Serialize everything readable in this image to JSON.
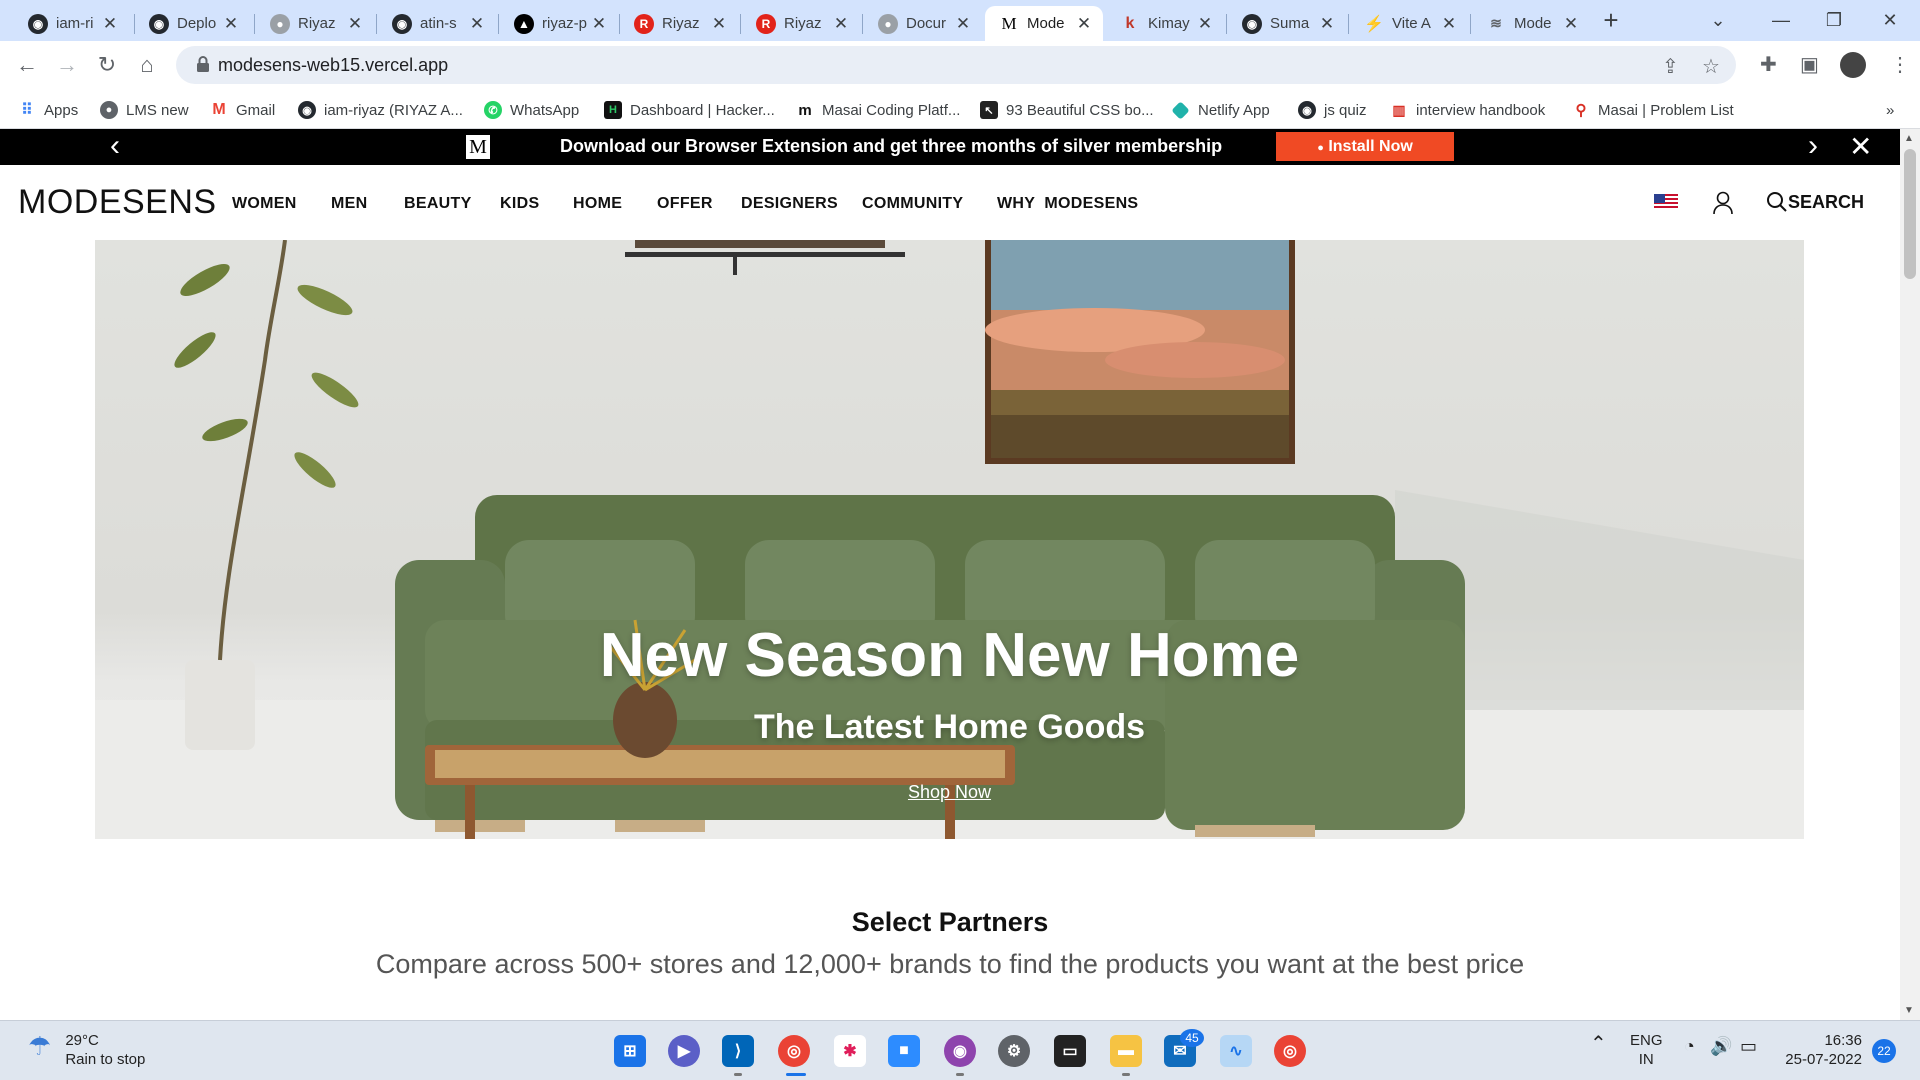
{
  "browser": {
    "tabs": [
      {
        "title": "iam-ri",
        "icon": "github-icon",
        "active": false
      },
      {
        "title": "Deplo",
        "icon": "github-icon",
        "active": false
      },
      {
        "title": "Riyaz",
        "icon": "globe-icon",
        "active": false
      },
      {
        "title": "atin-s",
        "icon": "github-icon",
        "active": false
      },
      {
        "title": "riyaz-p",
        "icon": "vercel-icon",
        "active": false
      },
      {
        "title": "Riyaz",
        "icon": "r-logo-icon",
        "active": false
      },
      {
        "title": "Riyaz",
        "icon": "r-logo-icon",
        "active": false
      },
      {
        "title": "Docur",
        "icon": "globe-icon",
        "active": false
      },
      {
        "title": "Mode",
        "icon": "modesens-icon",
        "active": true
      },
      {
        "title": "Kimay",
        "icon": "kimaya-icon",
        "active": false
      },
      {
        "title": "Suma",
        "icon": "github-icon",
        "active": false
      },
      {
        "title": "Vite A",
        "icon": "vite-icon",
        "active": false
      },
      {
        "title": "Mode",
        "icon": "modesens-small-icon",
        "active": false
      }
    ],
    "url": "modesens-web15.vercel.app",
    "bookmarks": [
      {
        "label": "Apps",
        "icon": "apps-grid-icon"
      },
      {
        "label": "LMS new",
        "icon": "globe-icon"
      },
      {
        "label": "Gmail",
        "icon": "gmail-icon"
      },
      {
        "label": "iam-riyaz (RIYAZ A...",
        "icon": "github-icon"
      },
      {
        "label": "WhatsApp",
        "icon": "whatsapp-icon"
      },
      {
        "label": "Dashboard | Hacker...",
        "icon": "hackerrank-icon"
      },
      {
        "label": "Masai Coding Platf...",
        "icon": "masai-icon"
      },
      {
        "label": "93 Beautiful CSS bo...",
        "icon": "css-icon"
      },
      {
        "label": "Netlify App",
        "icon": "netlify-icon"
      },
      {
        "label": "js quiz",
        "icon": "github-icon"
      },
      {
        "label": "interview handbook",
        "icon": "handbook-icon"
      },
      {
        "label": "Masai | Problem List",
        "icon": "masai-pin-icon"
      }
    ],
    "more_bookmarks": "»"
  },
  "promo": {
    "text": "Download our Browser Extension and get three months of silver membership",
    "install_label": "Install Now",
    "logo_letter": "M"
  },
  "header": {
    "logo": "MODESENS",
    "nav": [
      "WOMEN",
      "MEN",
      "BEAUTY",
      "KIDS",
      "HOME",
      "OFFER",
      "DESIGNERS",
      "COMMUNITY",
      "WHY  MODESENS"
    ],
    "search_label": "SEARCH"
  },
  "hero": {
    "title": "New Season New Home",
    "subtitle": "The Latest Home Goods",
    "cta": "Shop Now"
  },
  "partners": {
    "title": "Select Partners",
    "subtitle": "Compare across 500+ stores and 12,000+ brands to find the products you want at the best price"
  },
  "taskbar": {
    "weather_temp": "29°C",
    "weather_desc": "Rain to stop",
    "lang_1": "ENG",
    "lang_2": "IN",
    "time": "16:36",
    "date": "25-07-2022",
    "mail_badge": "45",
    "notif_badge": "22"
  },
  "colors": {
    "tab_strip": "#d3e3fd",
    "promo_bar": "#000000",
    "install_button": "#f04a24",
    "taskbar": "#dfe6ef",
    "sofa": "#667b53"
  }
}
